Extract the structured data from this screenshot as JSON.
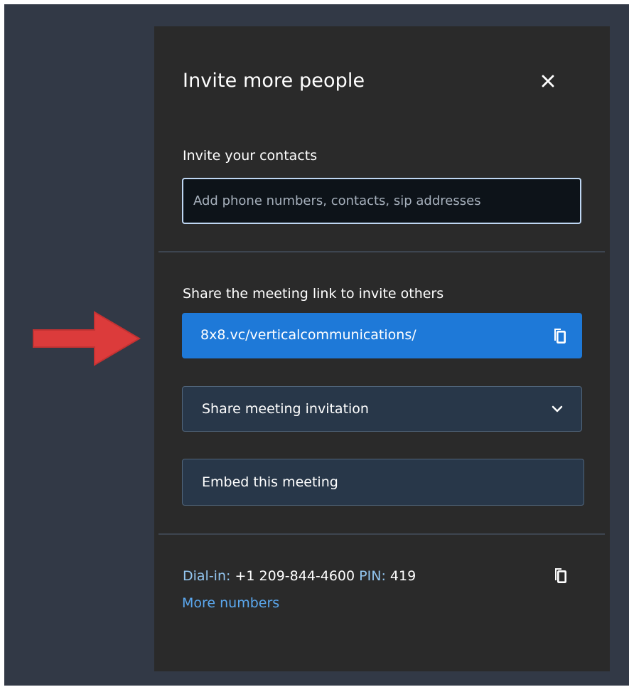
{
  "dialog": {
    "title": "Invite more people"
  },
  "invite_contacts": {
    "label": "Invite your contacts",
    "input_value": "",
    "placeholder": "Add phone numbers, contacts, sip addresses"
  },
  "meeting_link": {
    "label": "Share the meeting link to invite others",
    "url": "8x8.vc/verticalcommunications/"
  },
  "share_invitation": {
    "label": "Share meeting invitation"
  },
  "embed": {
    "label": "Embed this meeting"
  },
  "dial_in": {
    "label": "Dial-in:",
    "number": "+1 209-844-4600",
    "pin_label": "PIN:",
    "pin": "419",
    "more_numbers": "More numbers"
  },
  "icons": {
    "close": "close-icon",
    "copy_link": "copy-icon",
    "dropdown": "chevron-down-icon",
    "copy_dial_in": "copy-icon",
    "annotation": "red-arrow-icon"
  },
  "colors": {
    "background": "#323946",
    "dialog_background": "#2a2a2a",
    "input_background": "#0d1319",
    "input_border": "#bfd7f3",
    "link_button": "#1e79d8",
    "secondary_button": "#283749",
    "link_text": "#5ba8ef",
    "annotation_arrow": "#dc3b3b"
  }
}
